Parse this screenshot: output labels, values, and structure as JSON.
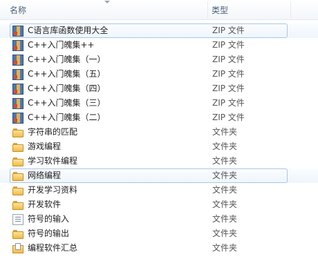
{
  "header": {
    "name_label": "名称",
    "type_label": "类型"
  },
  "rows": [
    {
      "name": "C语言库函数使用大全",
      "type": "ZIP 文件",
      "icon": "zip-archive-icon",
      "selected": true
    },
    {
      "name": "C++入门魄集++",
      "type": "ZIP 文件",
      "icon": "zip-archive-icon"
    },
    {
      "name": "C++入门魄集（一）",
      "type": "ZIP 文件",
      "icon": "zip-archive-icon"
    },
    {
      "name": "C++入门魄集（五）",
      "type": "ZIP 文件",
      "icon": "zip-archive-icon"
    },
    {
      "name": "C++入门魄集（四）",
      "type": "ZIP 文件",
      "icon": "zip-archive-icon"
    },
    {
      "name": "C++入门魄集（三）",
      "type": "ZIP 文件",
      "icon": "zip-archive-icon"
    },
    {
      "name": "C++入门魄集（二）",
      "type": "ZIP 文件",
      "icon": "zip-archive-icon"
    },
    {
      "name": "字符串的匹配",
      "type": "文件夹",
      "icon": "folder-icon"
    },
    {
      "name": "游戏编程",
      "type": "文件夹",
      "icon": "folder-icon"
    },
    {
      "name": "学习软件编程",
      "type": "文件夹",
      "icon": "folder-icon"
    },
    {
      "name": "网络编程",
      "type": "文件夹",
      "icon": "folder-icon",
      "selected": true
    },
    {
      "name": "开发学习资料",
      "type": "文件夹",
      "icon": "folder-icon"
    },
    {
      "name": "开发软件",
      "type": "文件夹",
      "icon": "folder-icon"
    },
    {
      "name": "符号的输入",
      "type": "文件夹",
      "icon": "text-document-icon"
    },
    {
      "name": "符号的输出",
      "type": "文件夹",
      "icon": "folder-icon"
    },
    {
      "name": "编程软件汇总",
      "type": "文件夹",
      "icon": "special-folder-icon"
    }
  ]
}
